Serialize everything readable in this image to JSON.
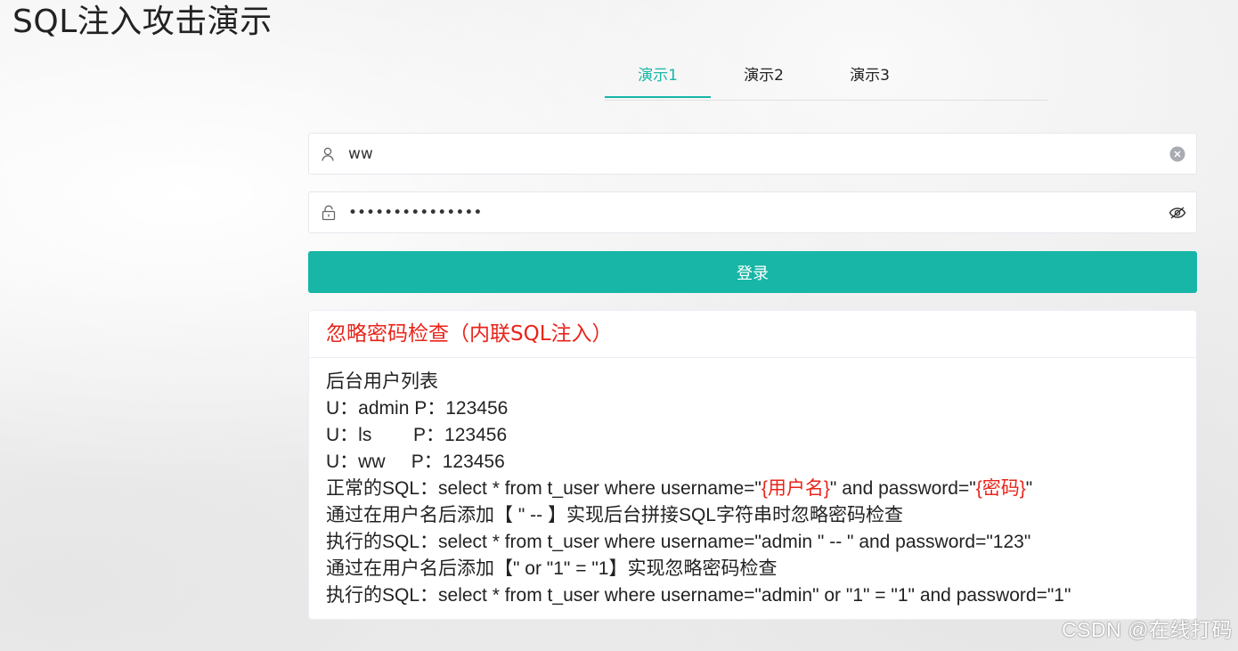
{
  "page": {
    "title": "SQL注入攻击演示"
  },
  "tabs": [
    {
      "label": "演示1",
      "active": true
    },
    {
      "label": "演示2",
      "active": false
    },
    {
      "label": "演示3",
      "active": false
    }
  ],
  "form": {
    "username_value": "ww",
    "password_value": "•••••••••••••••",
    "user_icon": "user-icon",
    "lock_icon": "lock-icon",
    "clear_icon": "clear-circle-icon",
    "eye_icon": "eye-slash-icon",
    "login_label": "登录"
  },
  "card": {
    "title": "忽略密码检查（内联SQL注入）",
    "list_title": "后台用户列表",
    "users": [
      {
        "u_label": "U：",
        "name": "admin",
        "p_label": "P：",
        "password": "123456",
        "gap": " "
      },
      {
        "u_label": "U：",
        "name": "ls",
        "p_label": "P：",
        "password": "123456",
        "gap": "        "
      },
      {
        "u_label": "U：",
        "name": "ww",
        "p_label": "P：",
        "password": "123456",
        "gap": "     "
      }
    ],
    "normal_sql_prefix": "正常的SQL：select * from t_user where username=\"",
    "normal_sql_user_placeholder": "{用户名}",
    "normal_sql_middle": "\" and password=\"",
    "normal_sql_pass_placeholder": "{密码}",
    "normal_sql_suffix": "\"",
    "tip1": "通过在用户名后添加【 \" -- 】实现后台拼接SQL字符串时忽略密码检查",
    "exec1": "执行的SQL：select * from t_user where username=\"admin \" -- \" and password=\"123\"",
    "tip2": "通过在用户名后添加【\" or \"1\" = \"1】实现忽略密码检查",
    "exec2": "执行的SQL：select * from t_user where username=\"admin\" or \"1\" = \"1\" and password=\"1\""
  },
  "colors": {
    "accent": "#17b6a6",
    "danger": "#e8241a"
  },
  "watermark": "CSDN @在线打码"
}
